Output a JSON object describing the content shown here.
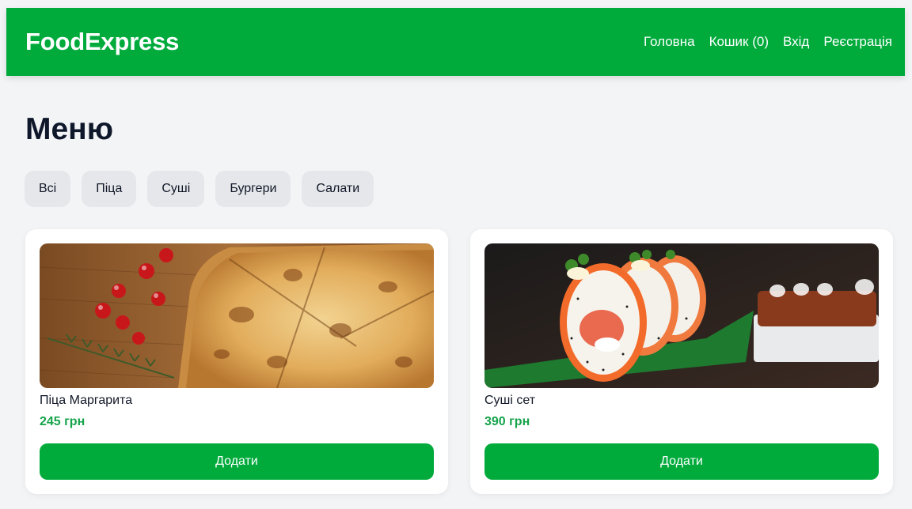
{
  "navbar": {
    "brand": "FoodExpress",
    "links": [
      {
        "label": "Головна"
      },
      {
        "label": "Кошик (0)"
      },
      {
        "label": "Вхід"
      },
      {
        "label": "Реєстрація"
      }
    ]
  },
  "menu": {
    "title": "Меню",
    "filters": [
      "Всі",
      "Піца",
      "Суші",
      "Бургери",
      "Салати"
    ]
  },
  "products": [
    {
      "name": "Піца Маргарита",
      "price": "245 грн",
      "button": "Додати",
      "image": "pizza-photo"
    },
    {
      "name": "Суші сет",
      "price": "390 грн",
      "button": "Додати",
      "image": "sushi-photo"
    }
  ],
  "colors": {
    "brand_green": "#00ab3c",
    "price_green": "#16a34a",
    "page_background": "#f3f4f6",
    "filter_background": "#e5e7eb"
  }
}
